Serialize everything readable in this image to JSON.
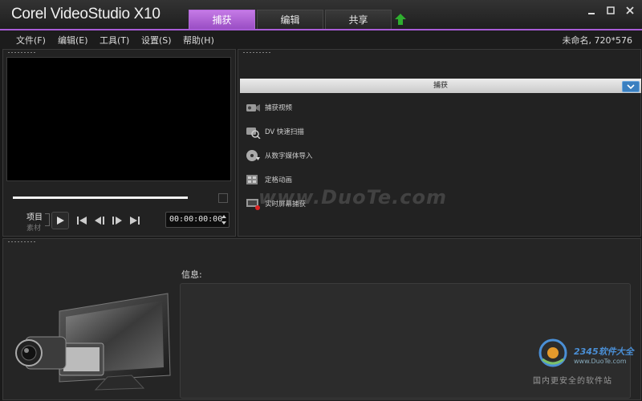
{
  "app": {
    "logo_text": "Corel VideoStudio X10",
    "tabs": [
      "捕获",
      "编辑",
      "共享"
    ],
    "active_tab": 0
  },
  "menu": [
    "文件(F)",
    "编辑(E)",
    "工具(T)",
    "设置(S)",
    "帮助(H)"
  ],
  "project_info": "未命名, 720*576",
  "player": {
    "mode_project": "项目",
    "mode_clip": "素材",
    "timecode": "00:00:00:00"
  },
  "capture": {
    "header": "捕获",
    "items": [
      {
        "label": "捕获视频",
        "icon": "camcorder-icon"
      },
      {
        "label": "DV 快速扫描",
        "icon": "dv-scan-icon"
      },
      {
        "label": "从数字媒体导入",
        "icon": "disc-import-icon"
      },
      {
        "label": "定格动画",
        "icon": "stop-motion-icon"
      },
      {
        "label": "实时屏幕捕获",
        "icon": "screen-capture-icon"
      }
    ]
  },
  "watermark": "www.DuoTe.com",
  "info": {
    "label": "信息:"
  },
  "site": {
    "name": "2345软件大全",
    "url": "www.DuoTe.com",
    "slogan": "国内更安全的软件站"
  },
  "colors": {
    "accent": "#a85cd6",
    "tab_active": "#b36ad8",
    "dropdown_blue": "#3a7fc0",
    "upload_green": "#2fae2f"
  }
}
